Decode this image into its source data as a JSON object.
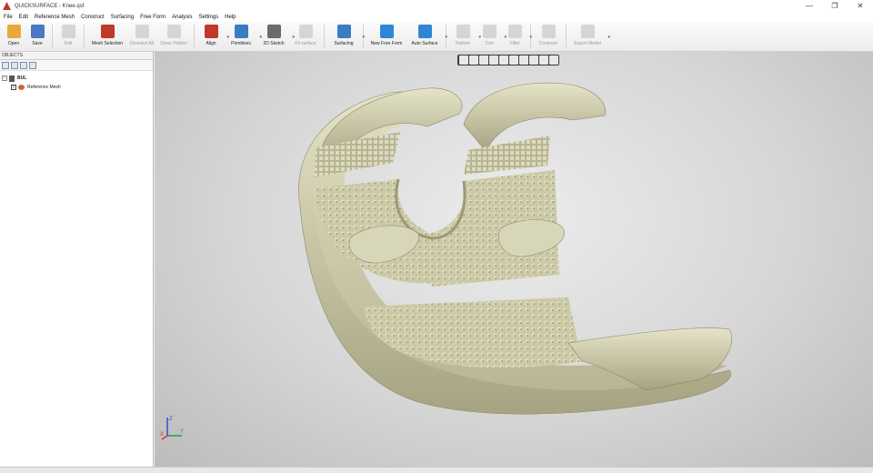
{
  "window": {
    "title": "QUICKSURFACE - Knee.qsf",
    "minimize_glyph": "—",
    "restore_glyph": "❐",
    "close_glyph": "✕"
  },
  "menu": [
    "File",
    "Edit",
    "Reference Mesh",
    "Construct",
    "Surfacing",
    "Free Form",
    "Analysis",
    "Settings",
    "Help"
  ],
  "toolbar": [
    {
      "label": "Open",
      "icon": "folder-icon",
      "color": "#e8a93a"
    },
    {
      "label": "Save",
      "icon": "save-icon",
      "color": "#4a78c2"
    },
    {
      "label": "Edit",
      "icon": "edit-icon",
      "color": "#9a9a9a",
      "disabled": true
    },
    {
      "label": "Mesh Selection",
      "icon": "mesh-selection-icon",
      "color": "#c0392b"
    },
    {
      "label": "Deselect All",
      "icon": "deselect-icon",
      "color": "#9a9a9a",
      "disabled": true
    },
    {
      "label": "Show Hidden",
      "icon": "eye-icon",
      "color": "#9a9a9a",
      "disabled": true
    },
    {
      "label": "Align",
      "icon": "align-icon",
      "color": "#c0392b",
      "arrow": true
    },
    {
      "label": "Primitives",
      "icon": "primitives-icon",
      "color": "#3a7cc2",
      "arrow": true
    },
    {
      "label": "2D Sketch",
      "icon": "sketch-icon",
      "color": "#6b6b6b",
      "arrow": true
    },
    {
      "label": "Fit surface",
      "icon": "fit-surface-icon",
      "color": "#9a9a9a",
      "disabled": true
    },
    {
      "label": "Surfacing",
      "icon": "surfacing-icon",
      "color": "#3a7cc2",
      "arrow": true
    },
    {
      "label": "New Free Form",
      "icon": "free-form-icon",
      "color": "#2f86d6"
    },
    {
      "label": "Auto Surface",
      "icon": "auto-surface-icon",
      "color": "#2f86d6",
      "arrow": true
    },
    {
      "label": "Pattern",
      "icon": "pattern-icon",
      "color": "#9a9a9a",
      "disabled": true,
      "arrow": true
    },
    {
      "label": "Trim",
      "icon": "trim-icon",
      "color": "#9a9a9a",
      "disabled": true,
      "arrow": true
    },
    {
      "label": "Fillet",
      "icon": "fillet-icon",
      "color": "#9a9a9a",
      "disabled": true,
      "arrow": true
    },
    {
      "label": "Compare",
      "icon": "compare-icon",
      "color": "#9a9a9a",
      "disabled": true
    },
    {
      "label": "Export Model",
      "icon": "export-icon",
      "color": "#9a9a9a",
      "disabled": true,
      "arrow": true
    }
  ],
  "panel": {
    "header": "OBJECTS",
    "tree": [
      {
        "label": "BUL",
        "level": 0,
        "toggle": "−"
      },
      {
        "label": "Reference Mesh",
        "level": 1,
        "checked": true
      }
    ]
  },
  "viewport": {
    "background_center": "#ececec",
    "model_color": "#d6d4b4",
    "axes": {
      "x": "X",
      "y": "Y",
      "z": "Z"
    }
  }
}
